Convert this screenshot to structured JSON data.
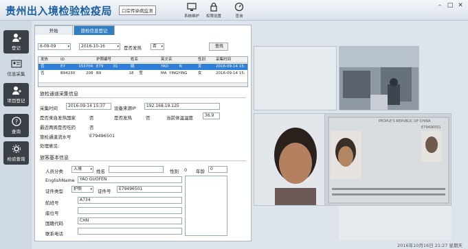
{
  "app": {
    "title": "贵州出入境检验检疫局",
    "subtitle": "口岸传染病监测"
  },
  "toolbar": {
    "system_label": "系统维护",
    "permission_label": "权限设置",
    "query_label": "查询"
  },
  "sidebar": {
    "items": [
      {
        "label": "登记"
      },
      {
        "label": "信息采集"
      },
      {
        "label": "项目登记"
      },
      {
        "label": "查询"
      },
      {
        "label": "检验查询"
      }
    ]
  },
  "tabs": [
    {
      "label": "开始"
    },
    {
      "label": "旅检信息登记"
    }
  ],
  "filters": {
    "date_from": "6-09-09",
    "date_to": "2016-10-16",
    "fever_label": "是否发热",
    "fever_value": "否",
    "search_label": "查找"
  },
  "grid": {
    "headers": [
      "发热",
      "ID",
      "护照编号",
      "姓名",
      "英文名",
      "性别",
      "采集时间"
    ],
    "rows": [
      [
        "否",
        "E7           153704",
        "E79        01",
        "姚",
        "YAO         N",
        "女",
        "2016-09-14 15:"
      ],
      [
        "否",
        "B94230         208",
        "B9                       18",
        "       莹",
        "MA  YINGYING",
        "女",
        "2016-09-14 15:"
      ]
    ]
  },
  "collect": {
    "section_title": "旅检通道采集信息",
    "time_label": "采集时间",
    "time_value": "2016-09-14 15:37",
    "ip_label": "设备来源IP",
    "ip_value": "192.168.19.125",
    "epidemic_label": "是否来自发热国家",
    "epidemic_value": "否",
    "fever_label": "是否发热",
    "fever_value": "否",
    "temp_label": "当前体温温度",
    "temp_value": "36.9",
    "medicine_label": "最近两周是否吃药",
    "medicine_value": "否",
    "serial_label": "旅检通道流水号",
    "serial_value": "E79496501",
    "opinion_label": "处理意见:"
  },
  "basic": {
    "section_title": "旅客基本信息",
    "category_label": "人员分类",
    "category_value": "入境",
    "name_label": "姓名",
    "gender_label": "性别",
    "gender_value": "0",
    "age_label": "年龄",
    "age_value": "0",
    "english_label": "EnglishName",
    "english_value": "YAO GUOFEN",
    "id_type_label": "证件类型",
    "id_type_value": "护照",
    "id_no_label": "证件号",
    "id_no_value": "E79496501",
    "flight_label": "航班号",
    "flight_value": "A734",
    "seat_label": "座位号",
    "seat_value": "",
    "country_label": "国籍代码",
    "country_value": "CHN",
    "phone_label": "联系电话",
    "phone_value": ""
  },
  "passport": {
    "country": "PEOPLE'S REPUBLIC OF CHINA",
    "number": "E79496501"
  },
  "status": {
    "datetime": "2016年10月16日 21:27 星期天"
  }
}
